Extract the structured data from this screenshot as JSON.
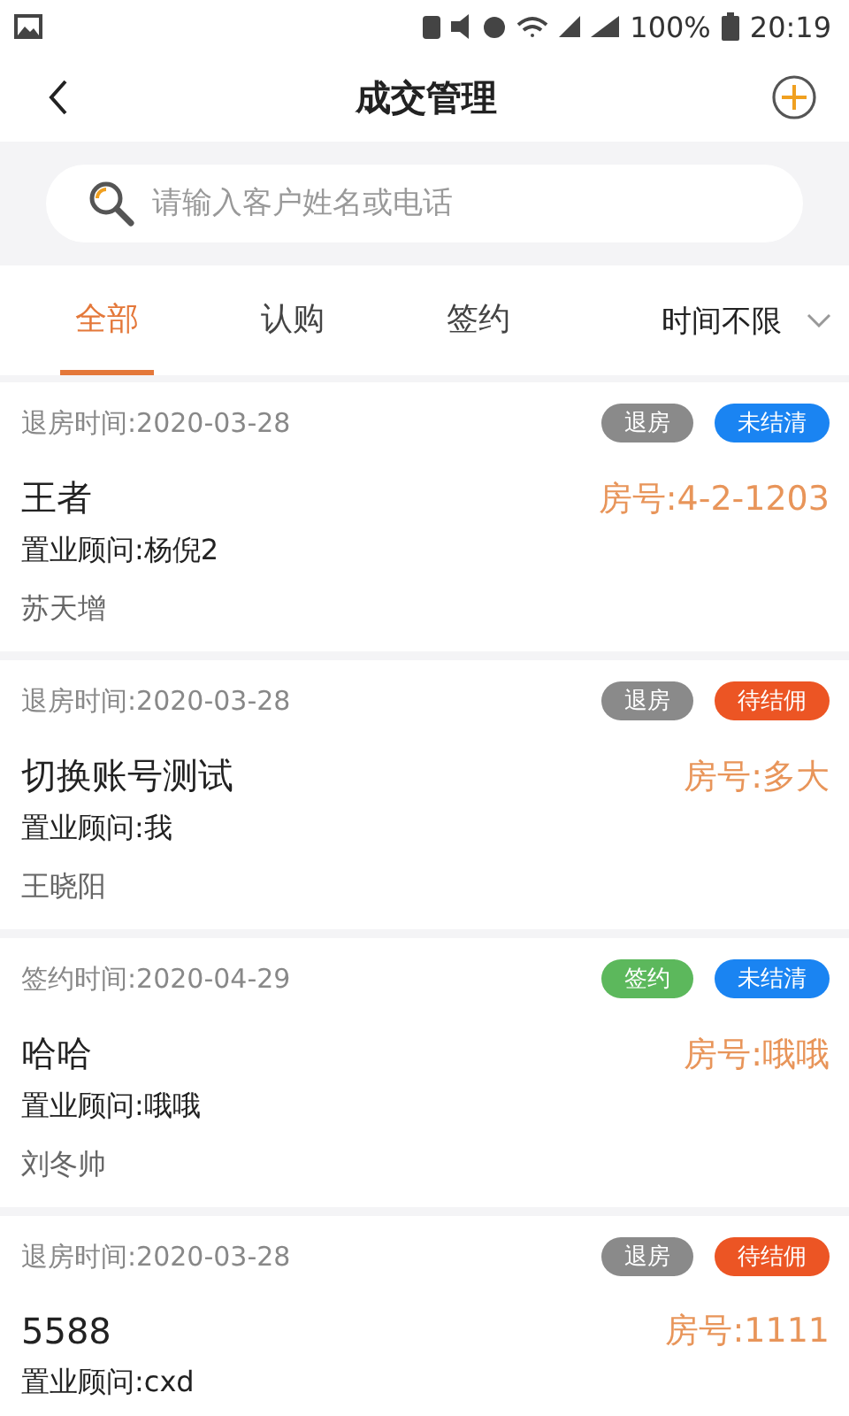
{
  "status_bar": {
    "battery": "100%",
    "time": "20:19"
  },
  "header": {
    "title": "成交管理"
  },
  "search": {
    "placeholder": "请输入客户姓名或电话"
  },
  "tabs": [
    {
      "label": "全部",
      "selected": true
    },
    {
      "label": "认购",
      "selected": false
    },
    {
      "label": "签约",
      "selected": false
    }
  ],
  "time_filter": {
    "label": "时间不限"
  },
  "deals": [
    {
      "time": "退房时间:2020-03-28",
      "tags": [
        {
          "label": "退房",
          "color": "#8a8a8a"
        },
        {
          "label": "未结清",
          "color": "#1a84f2"
        }
      ],
      "name": "王者",
      "room": "房号:4-2-1203",
      "consultant": "置业顾问:杨倪2",
      "customer": "苏天增"
    },
    {
      "time": "退房时间:2020-03-28",
      "tags": [
        {
          "label": "退房",
          "color": "#8a8a8a"
        },
        {
          "label": "待结佣",
          "color": "#ec5524"
        }
      ],
      "name": "切换账号测试",
      "room": "房号:多大",
      "consultant": "置业顾问:我",
      "customer": "王晓阳"
    },
    {
      "time": "签约时间:2020-04-29",
      "tags": [
        {
          "label": "签约",
          "color": "#5cb85c"
        },
        {
          "label": "未结清",
          "color": "#1a84f2"
        }
      ],
      "name": "哈哈",
      "room": "房号:哦哦",
      "consultant": "置业顾问:哦哦",
      "customer": "刘冬帅"
    },
    {
      "time": "退房时间:2020-03-28",
      "tags": [
        {
          "label": "退房",
          "color": "#8a8a8a"
        },
        {
          "label": "待结佣",
          "color": "#ec5524"
        }
      ],
      "name": "5588",
      "room": "房号:1111",
      "consultant": "置业顾问:cxd"
    }
  ]
}
